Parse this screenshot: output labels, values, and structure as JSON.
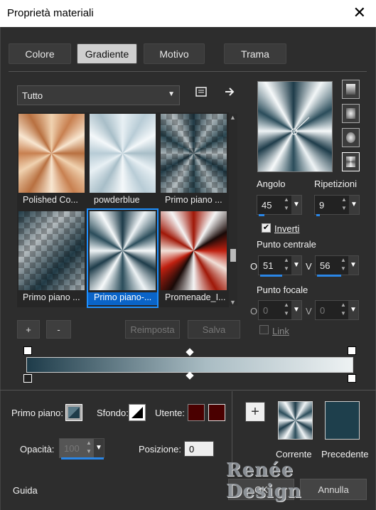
{
  "window": {
    "title": "Proprietà materiali",
    "close_glyph": "✕"
  },
  "tabs": [
    {
      "label": "Colore",
      "active": false
    },
    {
      "label": "Gradiente",
      "active": true
    },
    {
      "label": "Motivo",
      "active": false
    },
    {
      "label": "Trama",
      "active": false
    }
  ],
  "library": {
    "filter_value": "Tutto",
    "items": [
      {
        "label": "Polished Co..."
      },
      {
        "label": "powderblue"
      },
      {
        "label": "Primo piano ..."
      },
      {
        "label": "Primo piano ..."
      },
      {
        "label": "Primo piano-...",
        "selected": true
      },
      {
        "label": "Promenade_I..."
      }
    ]
  },
  "buttons": {
    "add": "+",
    "remove": "-",
    "reset": "Reimposta",
    "save": "Salva"
  },
  "gradient": {
    "angle_label": "Angolo",
    "angle": "45",
    "repeats_label": "Ripetizioni",
    "repeats": "9",
    "invert_label": "Inverti",
    "invert": true,
    "center_label": "Punto centrale",
    "center_o": "51",
    "center_v": "56",
    "focal_label": "Punto focale",
    "focal_o": "0",
    "focal_v": "0",
    "link_label": "Link",
    "link": false,
    "o_letter": "O",
    "v_letter": "V"
  },
  "bottom": {
    "foreground_label": "Primo piano:",
    "background_label": "Sfondo:",
    "user_label": "Utente:",
    "opacity_label": "Opacità:",
    "opacity": "100",
    "position_label": "Posizione:",
    "position": "0",
    "current_label": "Corrente",
    "previous_label": "Precedente",
    "user_color_1": "#4a0000",
    "user_color_2": "#4a0000",
    "previous_color": "#1e3f4c"
  },
  "footer": {
    "help": "Guida",
    "ok": "OK",
    "cancel": "Annulla"
  },
  "watermark": "Renée Design"
}
